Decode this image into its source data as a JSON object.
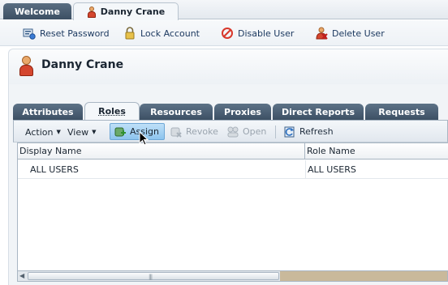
{
  "top_tabs": {
    "welcome": "Welcome",
    "active": "Danny Crane"
  },
  "actions": {
    "reset_password": "Reset Password",
    "lock_account": "Lock Account",
    "disable_user": "Disable User",
    "delete_user": "Delete User"
  },
  "header": {
    "user_name": "Danny Crane"
  },
  "sub_tabs": [
    "Attributes",
    "Roles",
    "Resources",
    "Proxies",
    "Direct Reports",
    "Requests"
  ],
  "roles_toolbar": {
    "action": "Action",
    "view": "View",
    "assign": "Assign",
    "revoke": "Revoke",
    "open": "Open",
    "refresh": "Refresh"
  },
  "table": {
    "columns": [
      "Display Name",
      "Role Name"
    ],
    "rows": [
      {
        "display_name": "ALL USERS",
        "role_name": "ALL USERS"
      }
    ]
  },
  "colors": {
    "accent": "#8cc4ee",
    "tab_dark": "#3d5064",
    "disable_red": "#d8372a"
  },
  "icons": [
    "user-icon",
    "reset-password-icon",
    "lock-icon",
    "disable-icon",
    "delete-user-icon",
    "assign-icon",
    "revoke-icon",
    "open-icon",
    "refresh-icon"
  ]
}
